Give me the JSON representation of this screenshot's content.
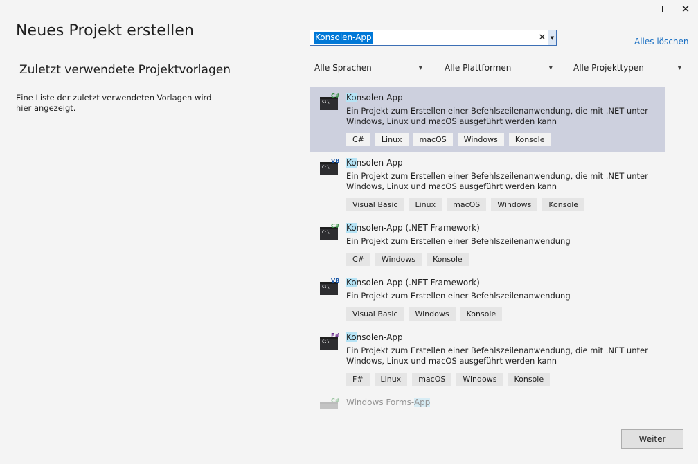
{
  "window": {
    "maximize_icon": "maximize-icon",
    "close_label": "✕"
  },
  "page": {
    "title": "Neues Projekt erstellen"
  },
  "recent": {
    "title": "Zuletzt verwendete Projektvorlagen",
    "description": "Eine Liste der zuletzt verwendeten Vorlagen wird hier angezeigt."
  },
  "search": {
    "value": "Konsolen-App",
    "clear_label": "✕"
  },
  "clear_all_label": "Alles löschen",
  "filters": {
    "language": "Alle Sprachen",
    "platform": "Alle Plattformen",
    "project_type": "Alle Projekttypen"
  },
  "templates": [
    {
      "lang": "C#",
      "name_hl": "Ko",
      "name_rest": "nsolen-App",
      "desc": "Ein Projekt zum Erstellen einer Befehlszeilenanwendung, die mit .NET unter Windows, Linux und macOS ausgeführt werden kann",
      "tags": [
        "C#",
        "Linux",
        "macOS",
        "Windows",
        "Konsole"
      ]
    },
    {
      "lang": "VB",
      "name_hl": "Ko",
      "name_rest": "nsolen-App",
      "desc": "Ein Projekt zum Erstellen einer Befehlszeilenanwendung, die mit .NET unter Windows, Linux und macOS ausgeführt werden kann",
      "tags": [
        "Visual Basic",
        "Linux",
        "macOS",
        "Windows",
        "Konsole"
      ]
    },
    {
      "lang": "C#",
      "name_hl": "Ko",
      "name_rest": "nsolen-App (.NET Framework)",
      "desc": "Ein Projekt zum Erstellen einer Befehlszeilenanwendung",
      "tags": [
        "C#",
        "Windows",
        "Konsole"
      ]
    },
    {
      "lang": "VB",
      "name_hl": "Ko",
      "name_rest": "nsolen-App (.NET Framework)",
      "desc": "Ein Projekt zum Erstellen einer Befehlszeilenanwendung",
      "tags": [
        "Visual Basic",
        "Windows",
        "Konsole"
      ]
    },
    {
      "lang": "F#",
      "name_hl": "Ko",
      "name_rest": "nsolen-App",
      "desc": "Ein Projekt zum Erstellen einer Befehlszeilenanwendung, die mit .NET unter Windows, Linux und macOS ausgeführt werden kann",
      "tags": [
        "F#",
        "Linux",
        "macOS",
        "Windows",
        "Konsole"
      ]
    },
    {
      "lang": "C#",
      "name_plain": "Windows Forms-",
      "name_hl": "App"
    }
  ],
  "icon_screen_text": "C:\\",
  "next_label": "Weiter",
  "colors": {
    "selected_bg": "#cdd0de",
    "highlight": "#b5e3f5",
    "link": "#1a6fc2",
    "accent": "#0078d7"
  }
}
